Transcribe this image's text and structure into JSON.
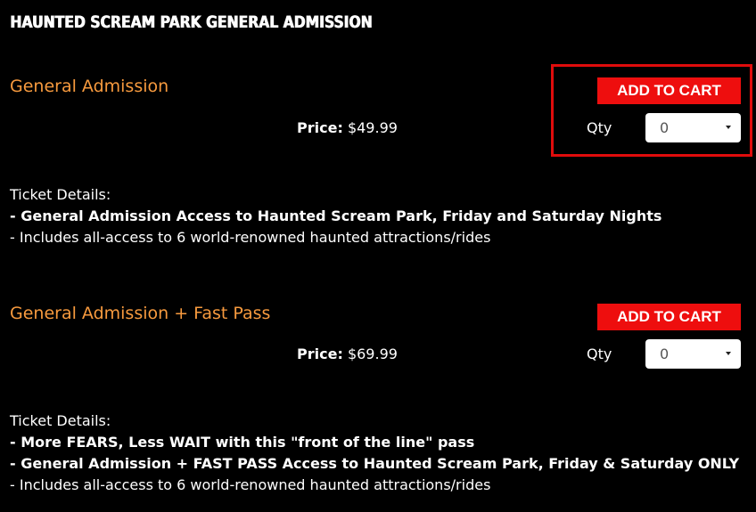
{
  "page": {
    "title": "Haunted Scream Park General Admission"
  },
  "tickets": [
    {
      "name": "General Admission",
      "add_label": "ADD TO CART",
      "price_label": "Price:",
      "price_value": "$49.99",
      "qty_label": "Qty",
      "qty_value": "0",
      "details_heading": "Ticket Details:",
      "details": [
        "- General Admission Access to Haunted Scream Park, Friday and Saturday Nights",
        "- Includes all-access to 6 world-renowned haunted attractions/rides"
      ]
    },
    {
      "name": "General Admission + Fast Pass",
      "add_label": "ADD TO CART",
      "price_label": "Price:",
      "price_value": "$69.99",
      "qty_label": "Qty",
      "qty_value": "0",
      "details_heading": "Ticket Details:",
      "details": [
        "- More FEARS, Less WAIT with this \"front of the line\" pass",
        "- General Admission + FAST PASS Access to Haunted Scream Park, Friday & Saturday ONLY",
        "- Includes all-access to 6 world-renowned haunted attractions/rides"
      ]
    }
  ],
  "icons": {
    "dropdown": "caret-down-icon"
  },
  "colors": {
    "background": "#000000",
    "ticket_name": "#f79a3e",
    "button": "#ee0e0e",
    "highlight": "#e00c0c"
  }
}
